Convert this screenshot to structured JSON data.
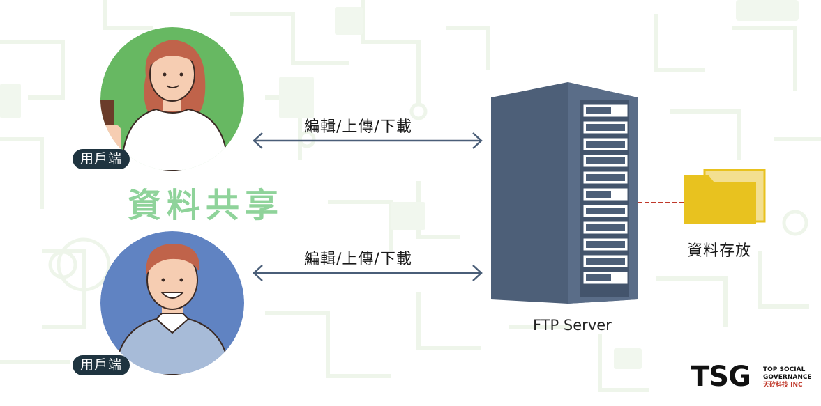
{
  "title": "資料共享",
  "users": [
    {
      "label": "用戶端"
    },
    {
      "label": "用戶端"
    }
  ],
  "connections": [
    {
      "label": "編輯/上傳/下載"
    },
    {
      "label": "編輯/上傳/下載"
    }
  ],
  "server": {
    "label": "FTP Server"
  },
  "storage": {
    "label": "資料存放"
  },
  "logo": {
    "mark": "TSG",
    "line1": "TOP   SOCIAL",
    "line2": "GOVERNANCE",
    "line3": "天矽科技       INC"
  },
  "colors": {
    "accent_green": "#8fd39a",
    "user1_bg": "#67b862",
    "user2_bg": "#6083c2",
    "server_body": "#4d5f78",
    "folder": "#e8c21f",
    "badge": "#1f3440",
    "arrow": "#4a5e78",
    "dashed_link": "#c0392b"
  }
}
